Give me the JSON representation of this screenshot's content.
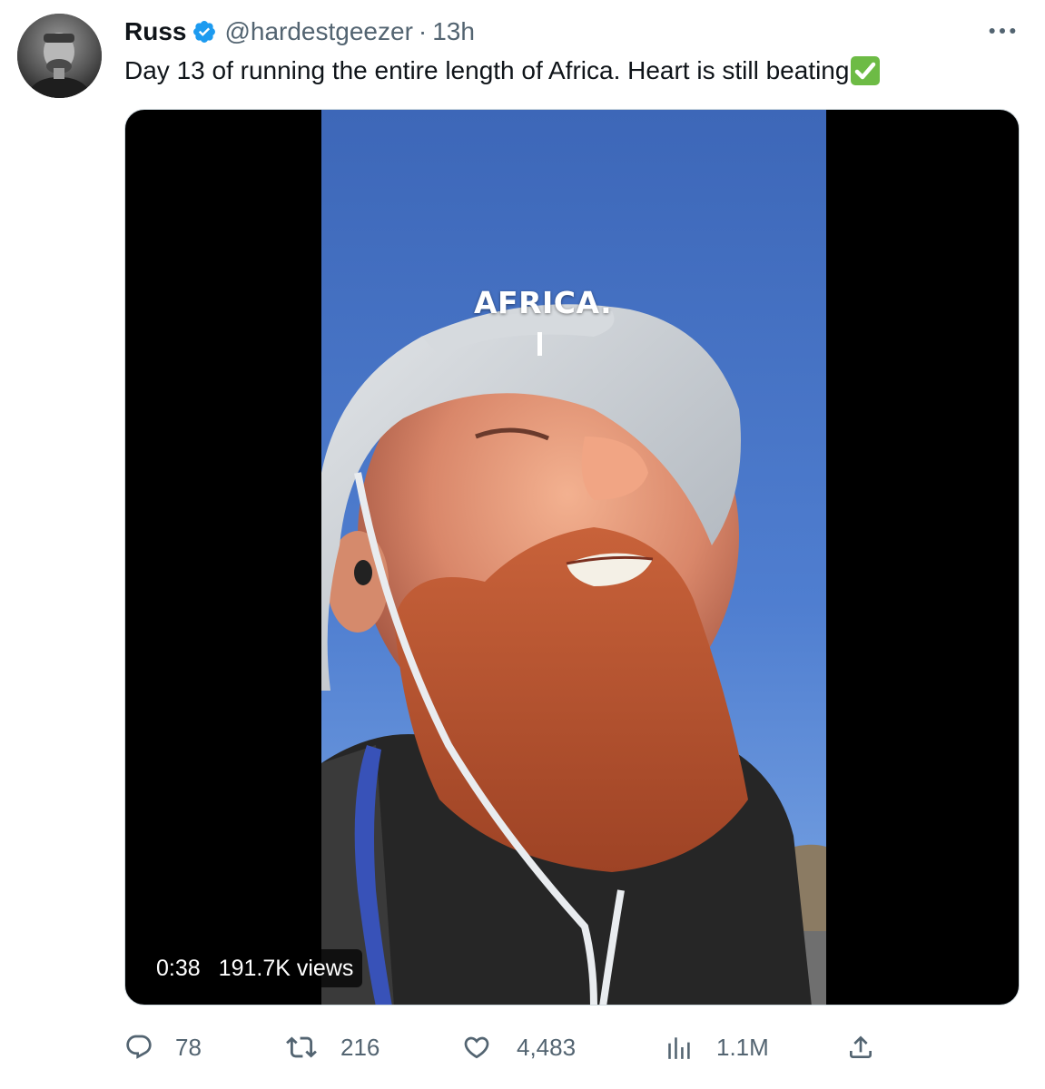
{
  "tweet": {
    "author": {
      "name": "Russ",
      "handle": "@hardestgeezer",
      "separator": "·",
      "time": "13h"
    },
    "text": "Day 13 of running the entire length of Africa. Heart is still beating",
    "emoji_icon": "white-heavy-check-mark-icon",
    "media": {
      "overlay_text": "AFRICA.",
      "duration": "0:38",
      "views": "191.7K views"
    },
    "actions": {
      "replies": "78",
      "retweets": "216",
      "likes": "4,483",
      "views": "1.1M"
    }
  },
  "colors": {
    "text_primary": "#0f1419",
    "text_secondary": "#536471",
    "verified_blue": "#1d9bf0",
    "border": "#cfd9de",
    "checkmark_green": "#6dbb45"
  }
}
